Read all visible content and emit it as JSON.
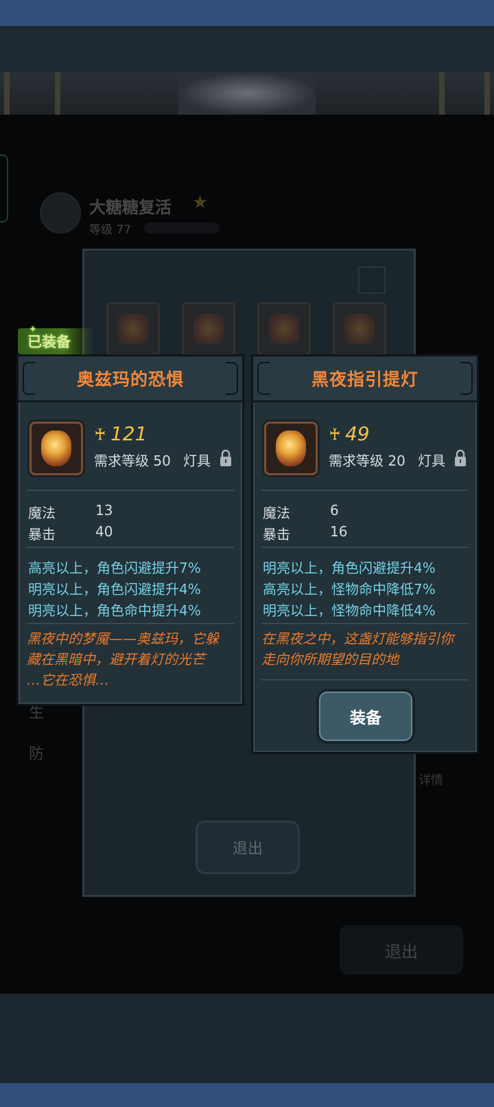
{
  "background": {
    "player_name": "大糖糖复活",
    "player_level": "等级 77",
    "side_label_1": "生",
    "side_label_2": "防",
    "detail_label": "详情",
    "exit_label_1": "退出",
    "exit_label_2": "退出"
  },
  "equipped_badge": "已装备",
  "cards": [
    {
      "title": "奥兹玛的恐惧",
      "score": "121",
      "requirement": "需求等级 50",
      "type": "灯具",
      "stats": [
        {
          "label": "魔法",
          "value": "13"
        },
        {
          "label": "暴击",
          "value": "40"
        }
      ],
      "effects": [
        "高亮以上，角色闪避提升7%",
        "明亮以上，角色闪避提升4%",
        "明亮以上，角色命中提升4%"
      ],
      "description": [
        "黑夜中的梦魇——奥兹玛，它躲",
        "藏在黑暗中，避开着灯的光芒",
        "…它在恐惧…"
      ]
    },
    {
      "title": "黑夜指引提灯",
      "score": "49",
      "requirement": "需求等级 20",
      "type": "灯具",
      "stats": [
        {
          "label": "魔法",
          "value": "6"
        },
        {
          "label": "暴击",
          "value": "16"
        }
      ],
      "effects": [
        "明亮以上，角色闪避提升4%",
        "高亮以上，怪物命中降低7%",
        "明亮以上，怪物命中降低4%"
      ],
      "description": [
        "在黑夜之中，这盏灯能够指引你",
        "走向你所期望的目的地"
      ],
      "equip_label": "装备"
    }
  ],
  "colors": {
    "title": "#f0873c",
    "effect": "#73d2e6",
    "description": "#ea7a2c",
    "score": "#f3c348",
    "status_bar": "#314e7c"
  }
}
